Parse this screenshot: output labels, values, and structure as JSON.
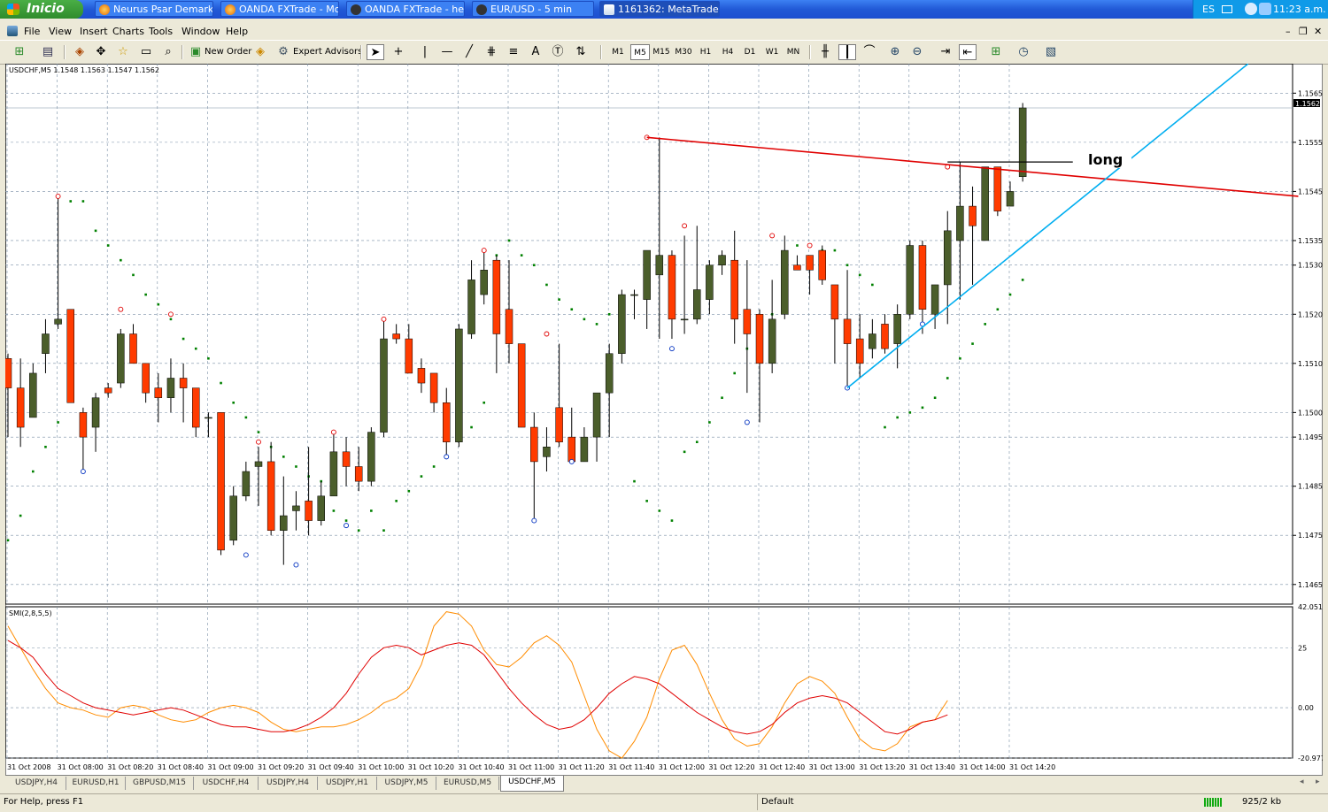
{
  "taskbar": {
    "start_label": "Inicio",
    "tasks": [
      {
        "label": "Neurus Psar Demark ..."
      },
      {
        "label": "OANDA FXTrade - Mo..."
      },
      {
        "label": "OANDA FXTrade - he..."
      },
      {
        "label": "EUR/USD - 5 min"
      },
      {
        "label": "1161362: MetaTrade..."
      }
    ],
    "language": "ES",
    "clock": "11:23 a.m."
  },
  "menu": {
    "items": [
      "File",
      "View",
      "Insert",
      "Charts",
      "Tools",
      "Window",
      "Help"
    ]
  },
  "toolbar": {
    "new_order": "New Order",
    "expert_advisors": "Expert Advisors",
    "timeframes": [
      "M1",
      "M5",
      "M15",
      "M30",
      "H1",
      "H4",
      "D1",
      "W1",
      "MN"
    ],
    "selected_timeframe": "M5",
    "text_tool": "A"
  },
  "chart": {
    "header": "USDCHF,M5  1.1548 1.1563 1.1547 1.1562",
    "current_price": "1.1562",
    "annotation": "long",
    "indicator_label": "SMI(2,8,5,5)",
    "up_color": "#4b5e2b",
    "down_color": "#ff3b00",
    "psar_color": "#008000",
    "trendline_color": "#e00000",
    "channel_color": "#00aef0",
    "smi_color": "#e00000",
    "signal_color": "#ff8c00"
  },
  "chart_data": {
    "type": "candlestick",
    "symbol": "USDCHF",
    "timeframe": "M5",
    "ylim": [
      1.1461,
      1.1571
    ],
    "price_ticks": [
      "1.1565",
      "1.1555",
      "1.1545",
      "1.1535",
      "1.1530",
      "1.1520",
      "1.1510",
      "1.1500",
      "1.1495",
      "1.1485",
      "1.1475",
      "1.1465"
    ],
    "time_labels": [
      "31 Oct 2008",
      "31 Oct 08:00",
      "31 Oct 08:20",
      "31 Oct 08:40",
      "31 Oct 09:00",
      "31 Oct 09:20",
      "31 Oct 09:40",
      "31 Oct 10:00",
      "31 Oct 10:20",
      "31 Oct 10:40",
      "31 Oct 11:00",
      "31 Oct 11:20",
      "31 Oct 11:40",
      "31 Oct 12:00",
      "31 Oct 12:20",
      "31 Oct 12:40",
      "31 Oct 13:00",
      "31 Oct 13:20",
      "31 Oct 13:40",
      "31 Oct 14:00",
      "31 Oct 14:20"
    ],
    "candles": [
      [
        1.1511,
        1.1512,
        1.1495,
        1.1505
      ],
      [
        1.1505,
        1.1511,
        1.1493,
        1.1497
      ],
      [
        1.1499,
        1.151,
        1.1499,
        1.1508
      ],
      [
        1.1512,
        1.1519,
        1.1508,
        1.1516
      ],
      [
        1.1518,
        1.1544,
        1.1517,
        1.1519
      ],
      [
        1.1521,
        1.152,
        1.1502,
        1.1502
      ],
      [
        1.15,
        1.1501,
        1.1488,
        1.1495
      ],
      [
        1.1497,
        1.1504,
        1.1492,
        1.1503
      ],
      [
        1.1505,
        1.1506,
        1.1503,
        1.1504
      ],
      [
        1.1506,
        1.1517,
        1.1505,
        1.1516
      ],
      [
        1.1516,
        1.1518,
        1.151,
        1.151
      ],
      [
        1.151,
        1.151,
        1.1502,
        1.1504
      ],
      [
        1.1505,
        1.1508,
        1.1498,
        1.1503
      ],
      [
        1.1503,
        1.1511,
        1.15,
        1.1507
      ],
      [
        1.1507,
        1.151,
        1.1498,
        1.1505
      ],
      [
        1.1505,
        1.1503,
        1.1495,
        1.1497
      ],
      [
        1.1499,
        1.15,
        1.1495,
        1.1499
      ],
      [
        1.15,
        1.15,
        1.1471,
        1.1472
      ],
      [
        1.1474,
        1.1485,
        1.1473,
        1.1483
      ],
      [
        1.1483,
        1.149,
        1.1482,
        1.1488
      ],
      [
        1.1489,
        1.1493,
        1.1481,
        1.149
      ],
      [
        1.149,
        1.1494,
        1.1475,
        1.1476
      ],
      [
        1.1476,
        1.1487,
        1.1469,
        1.1479
      ],
      [
        1.148,
        1.1484,
        1.1476,
        1.1481
      ],
      [
        1.1482,
        1.1493,
        1.1475,
        1.1478
      ],
      [
        1.1478,
        1.1486,
        1.1477,
        1.1483
      ],
      [
        1.1483,
        1.1496,
        1.1483,
        1.1492
      ],
      [
        1.1492,
        1.1495,
        1.1485,
        1.1489
      ],
      [
        1.1489,
        1.1493,
        1.1484,
        1.1486
      ],
      [
        1.1486,
        1.1497,
        1.1485,
        1.1496
      ],
      [
        1.1496,
        1.1519,
        1.1495,
        1.1515
      ],
      [
        1.1516,
        1.1518,
        1.1514,
        1.1515
      ],
      [
        1.1515,
        1.1518,
        1.1508,
        1.1508
      ],
      [
        1.1509,
        1.1511,
        1.1504,
        1.1506
      ],
      [
        1.1508,
        1.1507,
        1.15,
        1.1502
      ],
      [
        1.1502,
        1.1505,
        1.1491,
        1.1494
      ],
      [
        1.1494,
        1.1518,
        1.1493,
        1.1517
      ],
      [
        1.1516,
        1.1531,
        1.1515,
        1.1527
      ],
      [
        1.1524,
        1.1533,
        1.1522,
        1.1529
      ],
      [
        1.1531,
        1.1532,
        1.1508,
        1.1516
      ],
      [
        1.1521,
        1.1531,
        1.151,
        1.1514
      ],
      [
        1.1514,
        1.1512,
        1.1497,
        1.1497
      ],
      [
        1.1497,
        1.15,
        1.1478,
        1.149
      ],
      [
        1.1491,
        1.1497,
        1.1488,
        1.1493
      ],
      [
        1.1501,
        1.1514,
        1.1493,
        1.1494
      ],
      [
        1.1495,
        1.1501,
        1.1491,
        1.149
      ],
      [
        1.149,
        1.1497,
        1.149,
        1.1495
      ],
      [
        1.1495,
        1.1498,
        1.149,
        1.1504
      ],
      [
        1.1504,
        1.1514,
        1.1495,
        1.1512
      ],
      [
        1.1512,
        1.1525,
        1.151,
        1.1524
      ],
      [
        1.1524,
        1.1525,
        1.1519,
        1.1524
      ],
      [
        1.1523,
        1.1532,
        1.1517,
        1.1533
      ],
      [
        1.1528,
        1.1556,
        1.1515,
        1.1532
      ],
      [
        1.1532,
        1.1533,
        1.1515,
        1.1519
      ],
      [
        1.1519,
        1.1536,
        1.1516,
        1.1519
      ],
      [
        1.1519,
        1.1538,
        1.1518,
        1.1525
      ],
      [
        1.1523,
        1.1531,
        1.152,
        1.153
      ],
      [
        1.153,
        1.1533,
        1.1528,
        1.1532
      ],
      [
        1.1531,
        1.1537,
        1.1514,
        1.1519
      ],
      [
        1.1521,
        1.1531,
        1.1504,
        1.1516
      ],
      [
        1.152,
        1.1521,
        1.1498,
        1.151
      ],
      [
        1.151,
        1.1527,
        1.1508,
        1.1519
      ],
      [
        1.152,
        1.1536,
        1.1519,
        1.1533
      ],
      [
        1.153,
        1.1532,
        1.1529,
        1.1529
      ],
      [
        1.1532,
        1.1531,
        1.1524,
        1.1529
      ],
      [
        1.1533,
        1.1534,
        1.1526,
        1.1527
      ],
      [
        1.1526,
        1.1525,
        1.151,
        1.1519
      ],
      [
        1.1519,
        1.1529,
        1.1505,
        1.1514
      ],
      [
        1.1515,
        1.152,
        1.1507,
        1.151
      ],
      [
        1.1513,
        1.1519,
        1.1511,
        1.1516
      ],
      [
        1.1518,
        1.152,
        1.1512,
        1.1513
      ],
      [
        1.1514,
        1.1522,
        1.1509,
        1.152
      ],
      [
        1.152,
        1.1535,
        1.1519,
        1.1534
      ],
      [
        1.1534,
        1.1535,
        1.1516,
        1.1521
      ],
      [
        1.152,
        1.1526,
        1.1517,
        1.1526
      ],
      [
        1.1526,
        1.1541,
        1.1518,
        1.1537
      ],
      [
        1.1535,
        1.1551,
        1.1523,
        1.1542
      ],
      [
        1.1542,
        1.1546,
        1.1526,
        1.1538
      ],
      [
        1.1535,
        1.1547,
        1.1535,
        1.155
      ],
      [
        1.155,
        1.1547,
        1.154,
        1.1541
      ],
      [
        1.1542,
        1.1547,
        1.1543,
        1.1545
      ],
      [
        1.1548,
        1.1563,
        1.1547,
        1.1562
      ]
    ],
    "psar": [
      [
        0,
        1.1474
      ],
      [
        1,
        1.1479
      ],
      [
        2,
        1.1488
      ],
      [
        3,
        1.1493
      ],
      [
        4,
        1.1498
      ],
      [
        5,
        1.1543
      ],
      [
        6,
        1.1543
      ],
      [
        7,
        1.1537
      ],
      [
        8,
        1.1534
      ],
      [
        9,
        1.1531
      ],
      [
        10,
        1.1528
      ],
      [
        11,
        1.1524
      ],
      [
        12,
        1.1522
      ],
      [
        13,
        1.1519
      ],
      [
        14,
        1.1515
      ],
      [
        15,
        1.1513
      ],
      [
        16,
        1.1511
      ],
      [
        17,
        1.1506
      ],
      [
        18,
        1.1502
      ],
      [
        19,
        1.1499
      ],
      [
        20,
        1.1496
      ],
      [
        21,
        1.1493
      ],
      [
        22,
        1.1491
      ],
      [
        23,
        1.1489
      ],
      [
        24,
        1.1487
      ],
      [
        25,
        1.1486
      ],
      [
        26,
        1.148
      ],
      [
        27,
        1.1478
      ],
      [
        28,
        1.1476
      ],
      [
        29,
        1.148
      ],
      [
        30,
        1.1476
      ],
      [
        31,
        1.1482
      ],
      [
        32,
        1.1484
      ],
      [
        33,
        1.1487
      ],
      [
        34,
        1.1489
      ],
      [
        35,
        1.1491
      ],
      [
        36,
        1.1495
      ],
      [
        37,
        1.1497
      ],
      [
        38,
        1.1502
      ],
      [
        39,
        1.1532
      ],
      [
        40,
        1.1535
      ],
      [
        41,
        1.1532
      ],
      [
        42,
        1.153
      ],
      [
        43,
        1.1526
      ],
      [
        44,
        1.1523
      ],
      [
        45,
        1.1521
      ],
      [
        46,
        1.1519
      ],
      [
        47,
        1.1518
      ],
      [
        48,
        1.152
      ],
      [
        49,
        1.1514
      ],
      [
        50,
        1.1486
      ],
      [
        51,
        1.1482
      ],
      [
        52,
        1.148
      ],
      [
        53,
        1.1478
      ],
      [
        54,
        1.1492
      ],
      [
        55,
        1.1494
      ],
      [
        56,
        1.1498
      ],
      [
        57,
        1.1503
      ],
      [
        58,
        1.1508
      ],
      [
        59,
        1.1513
      ],
      [
        60,
        1.1517
      ],
      [
        61,
        1.152
      ],
      [
        62,
        1.1522
      ],
      [
        63,
        1.1534
      ],
      [
        64,
        1.1531
      ],
      [
        65,
        1.1533
      ],
      [
        66,
        1.1533
      ],
      [
        67,
        1.153
      ],
      [
        68,
        1.1528
      ],
      [
        69,
        1.1526
      ],
      [
        70,
        1.1497
      ],
      [
        71,
        1.1499
      ],
      [
        72,
        1.15
      ],
      [
        73,
        1.1501
      ],
      [
        74,
        1.1503
      ],
      [
        75,
        1.1507
      ],
      [
        76,
        1.1511
      ],
      [
        77,
        1.1514
      ],
      [
        78,
        1.1518
      ],
      [
        79,
        1.1521
      ],
      [
        80,
        1.1524
      ],
      [
        81,
        1.1527
      ]
    ],
    "pivot_highs": [
      [
        4,
        1.1544
      ],
      [
        9,
        1.1521
      ],
      [
        13,
        1.152
      ],
      [
        20,
        1.1494
      ],
      [
        26,
        1.1496
      ],
      [
        30,
        1.1519
      ],
      [
        38,
        1.1533
      ],
      [
        43,
        1.1516
      ],
      [
        51,
        1.1556
      ],
      [
        54,
        1.1538
      ],
      [
        61,
        1.1536
      ],
      [
        64,
        1.1534
      ],
      [
        75,
        1.155
      ]
    ],
    "pivot_lows": [
      [
        6,
        1.1488
      ],
      [
        19,
        1.1471
      ],
      [
        23,
        1.1469
      ],
      [
        27,
        1.1477
      ],
      [
        35,
        1.1491
      ],
      [
        42,
        1.1478
      ],
      [
        45,
        1.149
      ],
      [
        53,
        1.1513
      ],
      [
        59,
        1.1498
      ],
      [
        67,
        1.1505
      ],
      [
        73,
        1.1518
      ]
    ],
    "resistance_line": {
      "from": [
        51,
        1.1556
      ],
      "to": [
        103,
        1.1544
      ]
    },
    "channel_line": {
      "from": [
        67,
        1.1505
      ],
      "to": [
        99,
        1.1571
      ]
    },
    "long_marker": {
      "from": [
        75,
        1.1551
      ],
      "to": [
        85,
        1.1551
      ]
    },
    "indicator": {
      "name": "SMI(2,8,5,5)",
      "ylim": [
        -20.9777,
        42.0519
      ],
      "ticks": [
        "42.0519",
        "25",
        "0.00",
        "-20.9777"
      ],
      "smi": [
        28,
        25,
        21,
        14,
        8,
        5,
        2,
        0,
        -1,
        -2,
        -3,
        -2,
        -1,
        0,
        -1,
        -3,
        -5,
        -7,
        -8,
        -8,
        -9,
        -10,
        -10,
        -9,
        -7,
        -4,
        0,
        6,
        14,
        21,
        25,
        26,
        25,
        22,
        24,
        26,
        27,
        26,
        22,
        15,
        8,
        2,
        -3,
        -7,
        -9,
        -8,
        -5,
        0,
        6,
        10,
        13,
        12,
        10,
        6,
        2,
        -2,
        -5,
        -8,
        -10,
        -11,
        -10,
        -7,
        -2,
        2,
        4,
        5,
        4,
        2,
        -2,
        -6,
        -10,
        -11,
        -9,
        -6,
        -5,
        -3
      ],
      "signal": [
        34,
        25,
        16,
        8,
        2,
        0,
        -1,
        -3,
        -4,
        0,
        1,
        0,
        -3,
        -5,
        -6,
        -5,
        -2,
        0,
        1,
        0,
        -2,
        -6,
        -9,
        -10,
        -9,
        -8,
        -8,
        -7,
        -5,
        -2,
        2,
        4,
        8,
        18,
        34,
        40,
        39,
        34,
        24,
        18,
        17,
        21,
        27,
        30,
        26,
        19,
        5,
        -9,
        -18,
        -21,
        -14,
        -4,
        12,
        24,
        26,
        18,
        6,
        -5,
        -13,
        -16,
        -15,
        -8,
        2,
        10,
        13,
        11,
        6,
        -4,
        -13,
        -17,
        -18,
        -15,
        -8,
        -6,
        -5,
        3
      ]
    }
  },
  "tabs": {
    "items": [
      "USDJPY,H4",
      "EURUSD,H1",
      "GBPUSD,M15",
      "USDCHF,H4",
      "USDJPY,H4",
      "USDJPY,H1",
      "USDJPY,M5",
      "EURUSD,M5",
      "USDCHF,M5"
    ],
    "active_index": 8
  },
  "status": {
    "help": "For Help, press F1",
    "profile": "Default",
    "traffic": "925/2 kb"
  }
}
